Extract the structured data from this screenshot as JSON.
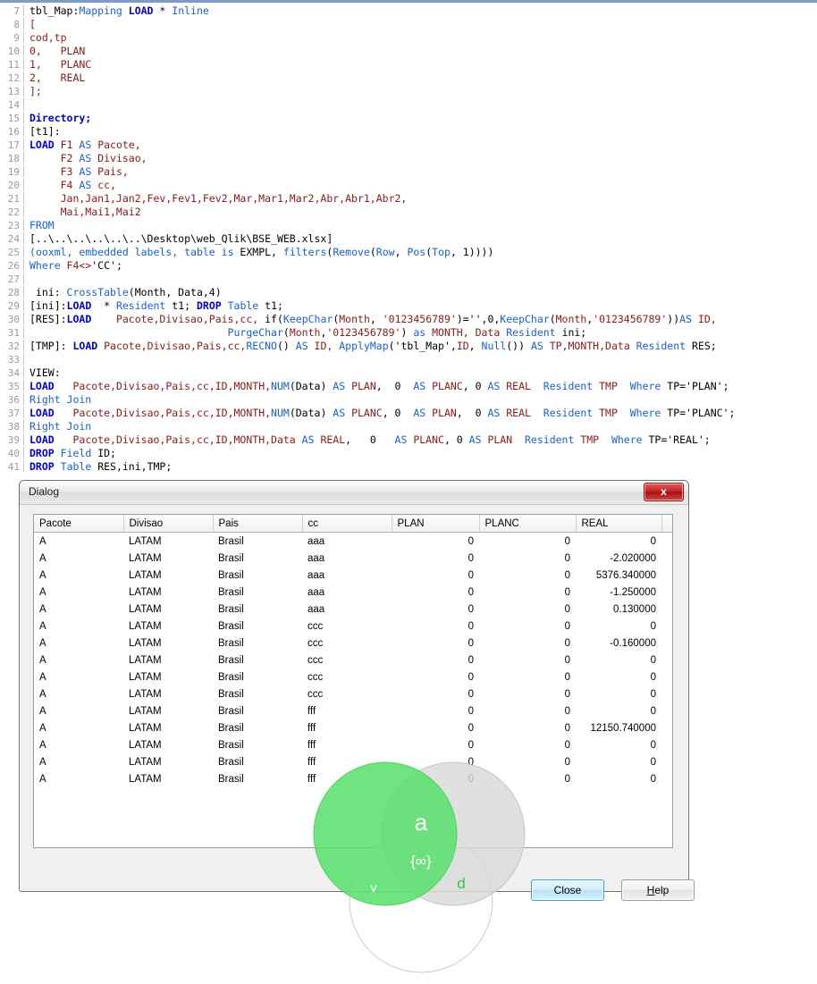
{
  "editor": {
    "name": "qlik-load-script-editor",
    "first_line_number": 7,
    "lines": [
      {
        "n": 7,
        "tokens": [
          {
            "t": "tbl_Map:",
            "c": "pl"
          },
          {
            "t": "Mapping ",
            "c": "fn"
          },
          {
            "t": "LOAD",
            "c": "kw"
          },
          {
            "t": " * ",
            "c": "pl"
          },
          {
            "t": "Inline",
            "c": "fn"
          }
        ]
      },
      {
        "n": 8,
        "tokens": [
          {
            "t": "[",
            "c": "id"
          }
        ]
      },
      {
        "n": 9,
        "tokens": [
          {
            "t": "cod,tp",
            "c": "id"
          }
        ]
      },
      {
        "n": 10,
        "tokens": [
          {
            "t": "0,   PLAN",
            "c": "id"
          }
        ]
      },
      {
        "n": 11,
        "tokens": [
          {
            "t": "1,   PLANC",
            "c": "id"
          }
        ]
      },
      {
        "n": 12,
        "tokens": [
          {
            "t": "2,   REAL",
            "c": "id"
          }
        ]
      },
      {
        "n": 13,
        "tokens": [
          {
            "t": "];",
            "c": "id"
          }
        ]
      },
      {
        "n": 14,
        "tokens": []
      },
      {
        "n": 15,
        "tokens": [
          {
            "t": "Directory;",
            "c": "kw"
          }
        ]
      },
      {
        "n": 16,
        "tokens": [
          {
            "t": "[t1]:",
            "c": "pl"
          }
        ]
      },
      {
        "n": 17,
        "tokens": [
          {
            "t": "LOAD",
            "c": "kw"
          },
          {
            "t": " F1 ",
            "c": "id"
          },
          {
            "t": "AS",
            "c": "blu"
          },
          {
            "t": " Pacote,",
            "c": "id"
          }
        ]
      },
      {
        "n": 18,
        "tokens": [
          {
            "t": "     F2 ",
            "c": "id"
          },
          {
            "t": "AS",
            "c": "blu"
          },
          {
            "t": " Divisao,",
            "c": "id"
          }
        ]
      },
      {
        "n": 19,
        "tokens": [
          {
            "t": "     F3 ",
            "c": "id"
          },
          {
            "t": "AS",
            "c": "blu"
          },
          {
            "t": " Pais,",
            "c": "id"
          }
        ]
      },
      {
        "n": 20,
        "tokens": [
          {
            "t": "     F4 ",
            "c": "id"
          },
          {
            "t": "AS",
            "c": "blu"
          },
          {
            "t": " cc,",
            "c": "id"
          }
        ]
      },
      {
        "n": 21,
        "tokens": [
          {
            "t": "     Jan,Jan1,Jan2,Fev,Fev1,Fev2,Mar,Mar1,Mar2,Abr,Abr1,Abr2,",
            "c": "id"
          }
        ]
      },
      {
        "n": 22,
        "tokens": [
          {
            "t": "     Mai,Mai1,Mai2",
            "c": "id"
          }
        ]
      },
      {
        "n": 23,
        "tokens": [
          {
            "t": "FROM",
            "c": "blu"
          }
        ]
      },
      {
        "n": 24,
        "tokens": [
          {
            "t": "[..\\..\\..\\..\\..\\..\\Desktop\\web_Qlik\\BSE_WEB.xlsx]",
            "c": "pl"
          }
        ]
      },
      {
        "n": 25,
        "tokens": [
          {
            "t": "(",
            "c": "blu"
          },
          {
            "t": "ooxml, embedded labels, table is ",
            "c": "blu"
          },
          {
            "t": "EXMPL",
            "c": "pl"
          },
          {
            "t": ", ",
            "c": "pl"
          },
          {
            "t": "filters",
            "c": "blu"
          },
          {
            "t": "(",
            "c": "pl"
          },
          {
            "t": "Remove",
            "c": "blu"
          },
          {
            "t": "(",
            "c": "pl"
          },
          {
            "t": "Row",
            "c": "blu"
          },
          {
            "t": ", ",
            "c": "pl"
          },
          {
            "t": "Pos",
            "c": "blu"
          },
          {
            "t": "(",
            "c": "pl"
          },
          {
            "t": "Top",
            "c": "blu"
          },
          {
            "t": ", 1))))",
            "c": "pl"
          }
        ]
      },
      {
        "n": 26,
        "tokens": [
          {
            "t": "Where",
            "c": "blu"
          },
          {
            "t": " F4<>",
            "c": "id"
          },
          {
            "t": "'CC';",
            "c": "pl"
          }
        ]
      },
      {
        "n": 27,
        "tokens": []
      },
      {
        "n": 28,
        "tokens": [
          {
            "t": " ini: ",
            "c": "pl"
          },
          {
            "t": "CrossTable",
            "c": "blu"
          },
          {
            "t": "(Month, Data,4)",
            "c": "pl"
          }
        ]
      },
      {
        "n": 29,
        "tokens": [
          {
            "t": "[ini]:",
            "c": "pl"
          },
          {
            "t": "LOAD",
            "c": "kw"
          },
          {
            "t": "  * ",
            "c": "pl"
          },
          {
            "t": "Resident",
            "c": "blu"
          },
          {
            "t": " t1; ",
            "c": "pl"
          },
          {
            "t": "DROP",
            "c": "kw"
          },
          {
            "t": " ",
            "c": "pl"
          },
          {
            "t": "Table",
            "c": "blu"
          },
          {
            "t": " t1;",
            "c": "pl"
          }
        ]
      },
      {
        "n": 30,
        "tokens": [
          {
            "t": "[RES]:",
            "c": "pl"
          },
          {
            "t": "LOAD",
            "c": "kw"
          },
          {
            "t": "    ",
            "c": "pl"
          },
          {
            "t": "Pacote,Divisao,Pais,cc,",
            "c": "id"
          },
          {
            "t": " if",
            "c": "pl"
          },
          {
            "t": "(",
            "c": "pl"
          },
          {
            "t": "KeepChar",
            "c": "blu"
          },
          {
            "t": "(",
            "c": "pl"
          },
          {
            "t": "Month",
            "c": "id"
          },
          {
            "t": ", ",
            "c": "pl"
          },
          {
            "t": "'0123456789'",
            "c": "id"
          },
          {
            "t": ")='',0,",
            "c": "pl"
          },
          {
            "t": "KeepChar",
            "c": "blu"
          },
          {
            "t": "(",
            "c": "pl"
          },
          {
            "t": "Month",
            "c": "id"
          },
          {
            "t": ",",
            "c": "pl"
          },
          {
            "t": "'0123456789'",
            "c": "id"
          },
          {
            "t": "))",
            "c": "pl"
          },
          {
            "t": "AS",
            "c": "blu"
          },
          {
            "t": " ID,",
            "c": "id"
          }
        ]
      },
      {
        "n": 31,
        "tokens": [
          {
            "t": "                                PurgeChar",
            "c": "blu"
          },
          {
            "t": "(",
            "c": "pl"
          },
          {
            "t": "Month",
            "c": "id"
          },
          {
            "t": ",",
            "c": "pl"
          },
          {
            "t": "'0123456789'",
            "c": "id"
          },
          {
            "t": ") ",
            "c": "pl"
          },
          {
            "t": "as",
            "c": "blu"
          },
          {
            "t": " MONTH, Data ",
            "c": "id"
          },
          {
            "t": "Resident",
            "c": "blu"
          },
          {
            "t": " ini;",
            "c": "pl"
          }
        ]
      },
      {
        "n": 32,
        "tokens": [
          {
            "t": "[TMP]: ",
            "c": "pl"
          },
          {
            "t": "LOAD",
            "c": "kw"
          },
          {
            "t": " ",
            "c": "pl"
          },
          {
            "t": "Pacote,Divisao,Pais,cc,",
            "c": "id"
          },
          {
            "t": "RECNO",
            "c": "blu"
          },
          {
            "t": "() ",
            "c": "pl"
          },
          {
            "t": "AS",
            "c": "blu"
          },
          {
            "t": " ID, ",
            "c": "id"
          },
          {
            "t": "ApplyMap",
            "c": "blu"
          },
          {
            "t": "('tbl_Map',",
            "c": "pl"
          },
          {
            "t": "ID",
            "c": "id"
          },
          {
            "t": ", ",
            "c": "pl"
          },
          {
            "t": "Null",
            "c": "blu"
          },
          {
            "t": "()) ",
            "c": "pl"
          },
          {
            "t": "AS",
            "c": "blu"
          },
          {
            "t": " TP,MONTH,",
            "c": "id"
          },
          {
            "t": "Data ",
            "c": "id"
          },
          {
            "t": "Resident",
            "c": "blu"
          },
          {
            "t": " RES;",
            "c": "pl"
          }
        ]
      },
      {
        "n": 33,
        "tokens": []
      },
      {
        "n": 34,
        "tokens": [
          {
            "t": "VIEW:",
            "c": "pl"
          }
        ]
      },
      {
        "n": 35,
        "tokens": [
          {
            "t": "LOAD",
            "c": "kw"
          },
          {
            "t": "   ",
            "c": "pl"
          },
          {
            "t": "Pacote,Divisao,Pais,cc,ID,MONTH,",
            "c": "id"
          },
          {
            "t": "NUM",
            "c": "blu"
          },
          {
            "t": "(Data) ",
            "c": "pl"
          },
          {
            "t": "AS",
            "c": "blu"
          },
          {
            "t": " PLAN",
            "c": "id"
          },
          {
            "t": ",  0  ",
            "c": "pl"
          },
          {
            "t": "AS",
            "c": "blu"
          },
          {
            "t": " PLANC",
            "c": "id"
          },
          {
            "t": ", 0 ",
            "c": "pl"
          },
          {
            "t": "AS",
            "c": "blu"
          },
          {
            "t": " REAL",
            "c": "id"
          },
          {
            "t": "  ",
            "c": "pl"
          },
          {
            "t": "Resident",
            "c": "blu"
          },
          {
            "t": " TMP  ",
            "c": "id"
          },
          {
            "t": "Where",
            "c": "blu"
          },
          {
            "t": " TP='PLAN';",
            "c": "pl"
          }
        ]
      },
      {
        "n": 36,
        "tokens": [
          {
            "t": "Right Join",
            "c": "blu"
          }
        ]
      },
      {
        "n": 37,
        "tokens": [
          {
            "t": "LOAD",
            "c": "kw"
          },
          {
            "t": "   ",
            "c": "pl"
          },
          {
            "t": "Pacote,Divisao,Pais,cc,ID,MONTH,",
            "c": "id"
          },
          {
            "t": "NUM",
            "c": "blu"
          },
          {
            "t": "(Data) ",
            "c": "pl"
          },
          {
            "t": "AS",
            "c": "blu"
          },
          {
            "t": " PLANC",
            "c": "id"
          },
          {
            "t": ", 0  ",
            "c": "pl"
          },
          {
            "t": "AS",
            "c": "blu"
          },
          {
            "t": " PLAN",
            "c": "id"
          },
          {
            "t": ",  0 ",
            "c": "pl"
          },
          {
            "t": "AS",
            "c": "blu"
          },
          {
            "t": " REAL",
            "c": "id"
          },
          {
            "t": "  ",
            "c": "pl"
          },
          {
            "t": "Resident",
            "c": "blu"
          },
          {
            "t": " TMP  ",
            "c": "id"
          },
          {
            "t": "Where",
            "c": "blu"
          },
          {
            "t": " TP='PLANC';",
            "c": "pl"
          }
        ]
      },
      {
        "n": 38,
        "tokens": [
          {
            "t": "Right Join",
            "c": "blu"
          }
        ]
      },
      {
        "n": 39,
        "tokens": [
          {
            "t": "LOAD",
            "c": "kw"
          },
          {
            "t": "   ",
            "c": "pl"
          },
          {
            "t": "Pacote,Divisao,Pais,cc,ID,MONTH,Data ",
            "c": "id"
          },
          {
            "t": "AS",
            "c": "blu"
          },
          {
            "t": " REAL",
            "c": "id"
          },
          {
            "t": ",   0   ",
            "c": "pl"
          },
          {
            "t": "AS",
            "c": "blu"
          },
          {
            "t": " PLANC",
            "c": "id"
          },
          {
            "t": ", 0 ",
            "c": "pl"
          },
          {
            "t": "AS",
            "c": "blu"
          },
          {
            "t": " PLAN",
            "c": "id"
          },
          {
            "t": "  ",
            "c": "pl"
          },
          {
            "t": "Resident",
            "c": "blu"
          },
          {
            "t": " TMP  ",
            "c": "id"
          },
          {
            "t": "Where",
            "c": "blu"
          },
          {
            "t": " TP='REAL';",
            "c": "pl"
          }
        ]
      },
      {
        "n": 40,
        "tokens": [
          {
            "t": "DROP",
            "c": "kw"
          },
          {
            "t": " ",
            "c": "pl"
          },
          {
            "t": "Field",
            "c": "blu"
          },
          {
            "t": " ID;",
            "c": "pl"
          }
        ]
      },
      {
        "n": 41,
        "tokens": [
          {
            "t": "DROP",
            "c": "kw"
          },
          {
            "t": " ",
            "c": "pl"
          },
          {
            "t": "Table",
            "c": "blu"
          },
          {
            "t": " RES,ini,TMP;",
            "c": "pl"
          }
        ]
      }
    ],
    "colors": {
      "keyword": "#0000cc",
      "function": "#1a5fd6",
      "identifier": "#8b1a1a",
      "plain": "#000000",
      "gutter": "#9a9a9a",
      "top_rule": "#7a9cc6"
    }
  },
  "dialog": {
    "title": "Dialog",
    "close_icon_label": "x",
    "buttons": {
      "close": "Close",
      "help_prefix": "",
      "help_accel": "H",
      "help_rest": "elp"
    },
    "table": {
      "columns": [
        "Pacote",
        "Divisao",
        "Pais",
        "cc",
        "PLAN",
        "PLANC",
        "REAL"
      ],
      "column_align": [
        "left",
        "left",
        "left",
        "left",
        "right",
        "right",
        "right"
      ],
      "rows": [
        [
          "A",
          "LATAM",
          "Brasil",
          "aaa",
          "0",
          "0",
          "0"
        ],
        [
          "A",
          "LATAM",
          "Brasil",
          "aaa",
          "0",
          "0",
          "-2.020000"
        ],
        [
          "A",
          "LATAM",
          "Brasil",
          "aaa",
          "0",
          "0",
          "5376.340000"
        ],
        [
          "A",
          "LATAM",
          "Brasil",
          "aaa",
          "0",
          "0",
          "-1.250000"
        ],
        [
          "A",
          "LATAM",
          "Brasil",
          "aaa",
          "0",
          "0",
          "0.130000"
        ],
        [
          "A",
          "LATAM",
          "Brasil",
          "ccc",
          "0",
          "0",
          "0"
        ],
        [
          "A",
          "LATAM",
          "Brasil",
          "ccc",
          "0",
          "0",
          "-0.160000"
        ],
        [
          "A",
          "LATAM",
          "Brasil",
          "ccc",
          "0",
          "0",
          "0"
        ],
        [
          "A",
          "LATAM",
          "Brasil",
          "ccc",
          "0",
          "0",
          "0"
        ],
        [
          "A",
          "LATAM",
          "Brasil",
          "ccc",
          "0",
          "0",
          "0"
        ],
        [
          "A",
          "LATAM",
          "Brasil",
          "fff",
          "0",
          "0",
          "0"
        ],
        [
          "A",
          "LATAM",
          "Brasil",
          "fff",
          "0",
          "0",
          "12150.740000"
        ],
        [
          "A",
          "LATAM",
          "Brasil",
          "fff",
          "0",
          "0",
          "0"
        ],
        [
          "A",
          "LATAM",
          "Brasil",
          "fff",
          "0",
          "0",
          "0"
        ],
        [
          "A",
          "LATAM",
          "Brasil",
          "fff",
          "0",
          "0",
          "0"
        ]
      ]
    }
  },
  "watermark": {
    "name": "venn-logo-overlay",
    "glyph_a": "a",
    "glyph_infinity": "{∞}",
    "glyph_v": "v",
    "glyph_d": "d",
    "green": "#59e06b",
    "grey": "#dcdcdc"
  }
}
